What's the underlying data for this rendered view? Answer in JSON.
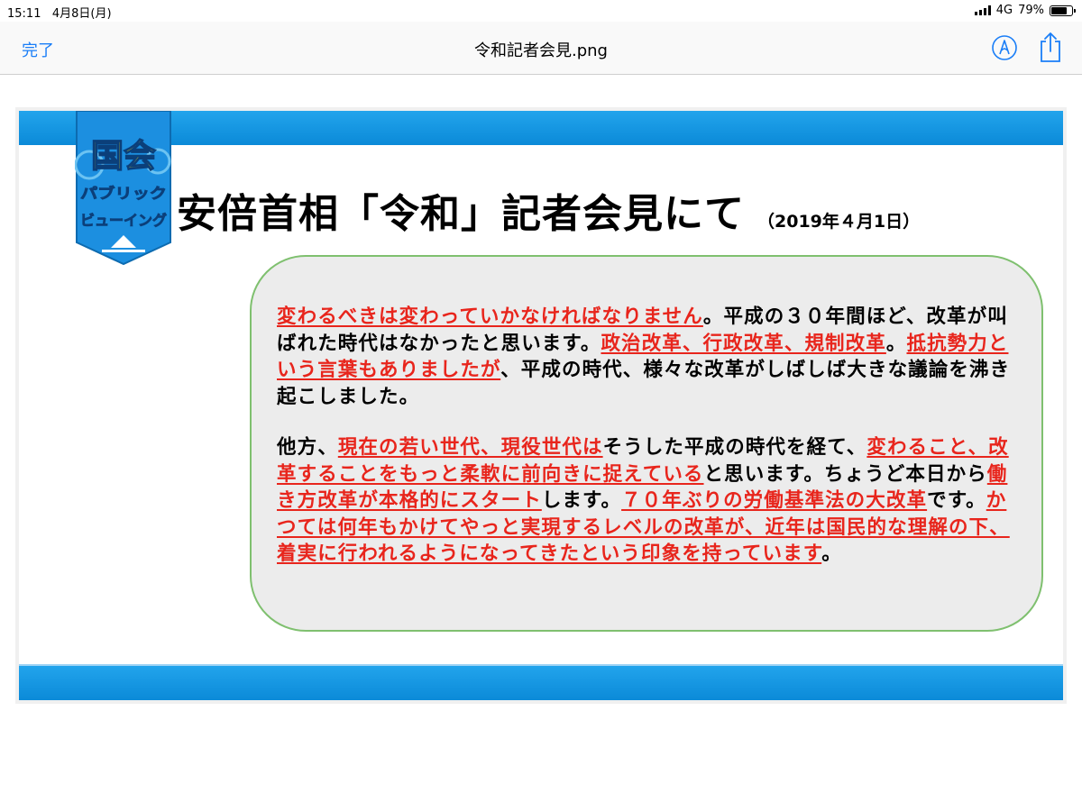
{
  "status_bar": {
    "time": "15:11",
    "date": "4月8日(月)",
    "network": "4G",
    "battery_percent": "79%",
    "battery_level": 0.79,
    "signal_icon": "signal-bars-icon",
    "battery_icon": "battery-icon"
  },
  "nav": {
    "done_label": "完了",
    "title": "令和記者会見.png",
    "markup_icon": "markup-pen-icon",
    "share_icon": "share-icon",
    "accent_color": "#1a7ef7"
  },
  "slide": {
    "logo": {
      "line1": "国会",
      "line2": "パブリック",
      "line3": "ビューイング"
    },
    "title": "安倍首相「令和」記者会見にて",
    "date": "（2019年４月1日）",
    "band_color": "#1697e3",
    "highlight_color": "#e8251c",
    "box_border_color": "#7fc06f",
    "quote": {
      "p1": [
        {
          "text": "変わるべきは変わっていかなければなりません",
          "hl": true
        },
        {
          "text": "。平成の３０年間ほど、改革が叫ばれた時代はなかったと思います。",
          "hl": false
        },
        {
          "text": "政治改革、行政改革、規制改革",
          "hl": true
        },
        {
          "text": "。",
          "hl": false
        },
        {
          "text": "抵抗勢力という言葉もありましたが",
          "hl": true
        },
        {
          "text": "、平成の時代、様々な改革がしばしば大きな議論を沸き起こしました。",
          "hl": false
        }
      ],
      "p2": [
        {
          "text": "他方、",
          "hl": false
        },
        {
          "text": "現在の若い世代、現役世代は",
          "hl": true
        },
        {
          "text": "そうした平成の時代を経て、",
          "hl": false
        },
        {
          "text": "変わること、改革することをもっと柔軟に前向きに捉えている",
          "hl": true
        },
        {
          "text": "と思います。ちょうど本日から",
          "hl": false
        },
        {
          "text": "働き方改革が本格的にスタート",
          "hl": true
        },
        {
          "text": "します。",
          "hl": false
        },
        {
          "text": "７０年ぶりの労働基準法の大改革",
          "hl": true
        },
        {
          "text": "です。",
          "hl": false
        },
        {
          "text": "かつては何年もかけてやっと実現するレベルの改革が、近年は国民的な理解の下、着実に行われるようになってきたという印象を持っています",
          "hl": true
        },
        {
          "text": "。",
          "hl": false
        }
      ]
    }
  }
}
